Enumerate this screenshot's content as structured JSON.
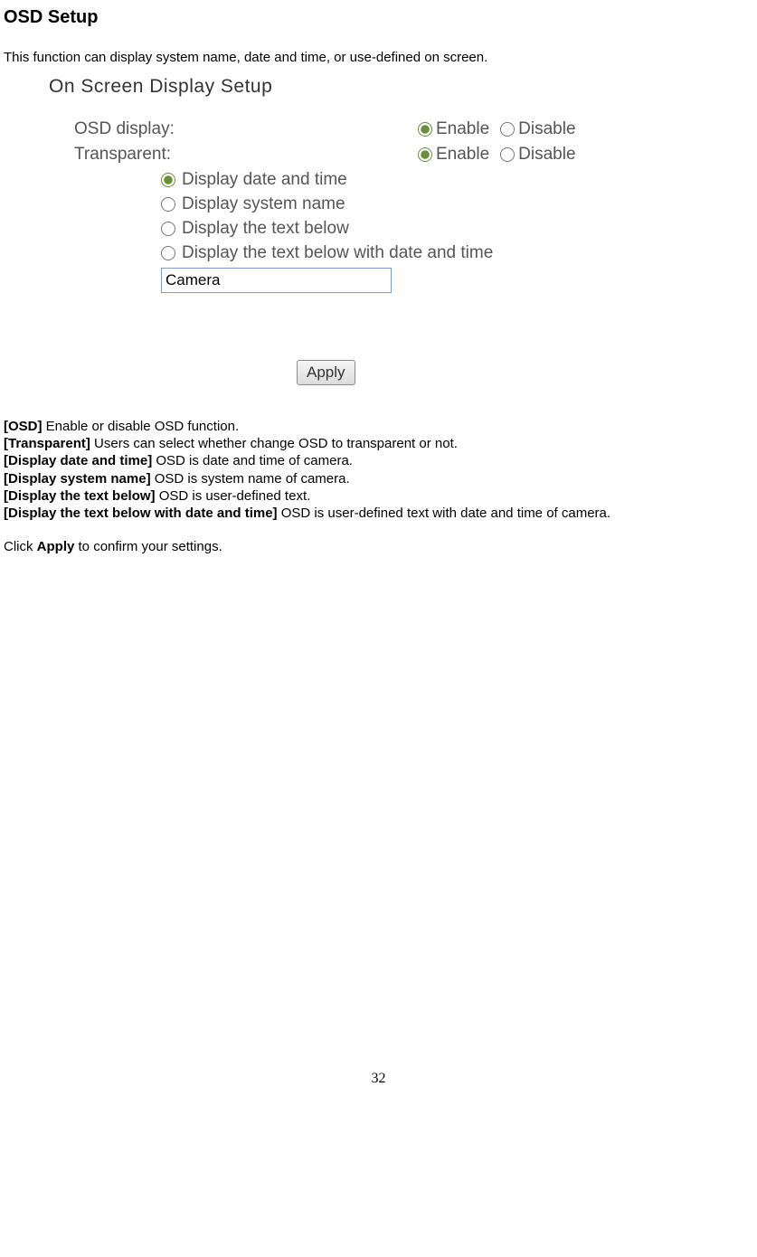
{
  "title": "OSD Setup",
  "intro": "This function can display system name, date and time, or use-defined on screen.",
  "panel": {
    "header": "On Screen Display Setup",
    "rows": {
      "osd_display": {
        "label": "OSD display:",
        "enable": "Enable",
        "disable": "Disable"
      },
      "transparent": {
        "label": "Transparent:",
        "enable": "Enable",
        "disable": "Disable"
      }
    },
    "options": {
      "opt1": "Display date and time",
      "opt2": "Display system name",
      "opt3": "Display the text below",
      "opt4": "Display the text below with date and time"
    },
    "text_value": "Camera",
    "apply": "Apply"
  },
  "desc": {
    "l1b": "[OSD] ",
    "l1t": "Enable or disable OSD function.",
    "l2b": "[Transparent] ",
    "l2t": "Users can select whether change OSD to transparent or not.",
    "l3b": "[Display date and time] ",
    "l3t": "OSD is date and time of camera.",
    "l4b": "[Display system name] ",
    "l4t": "OSD is system name of camera.",
    "l5b": "[Display the text below] ",
    "l5t": "OSD is user-defined text.",
    "l6b": "[Display the text below with date and time] ",
    "l6t": "OSD is user-defined text with date and time of camera.",
    "confirm_pre": "Click ",
    "confirm_bold": "Apply",
    "confirm_post": " to confirm your settings."
  },
  "page_number": "32"
}
